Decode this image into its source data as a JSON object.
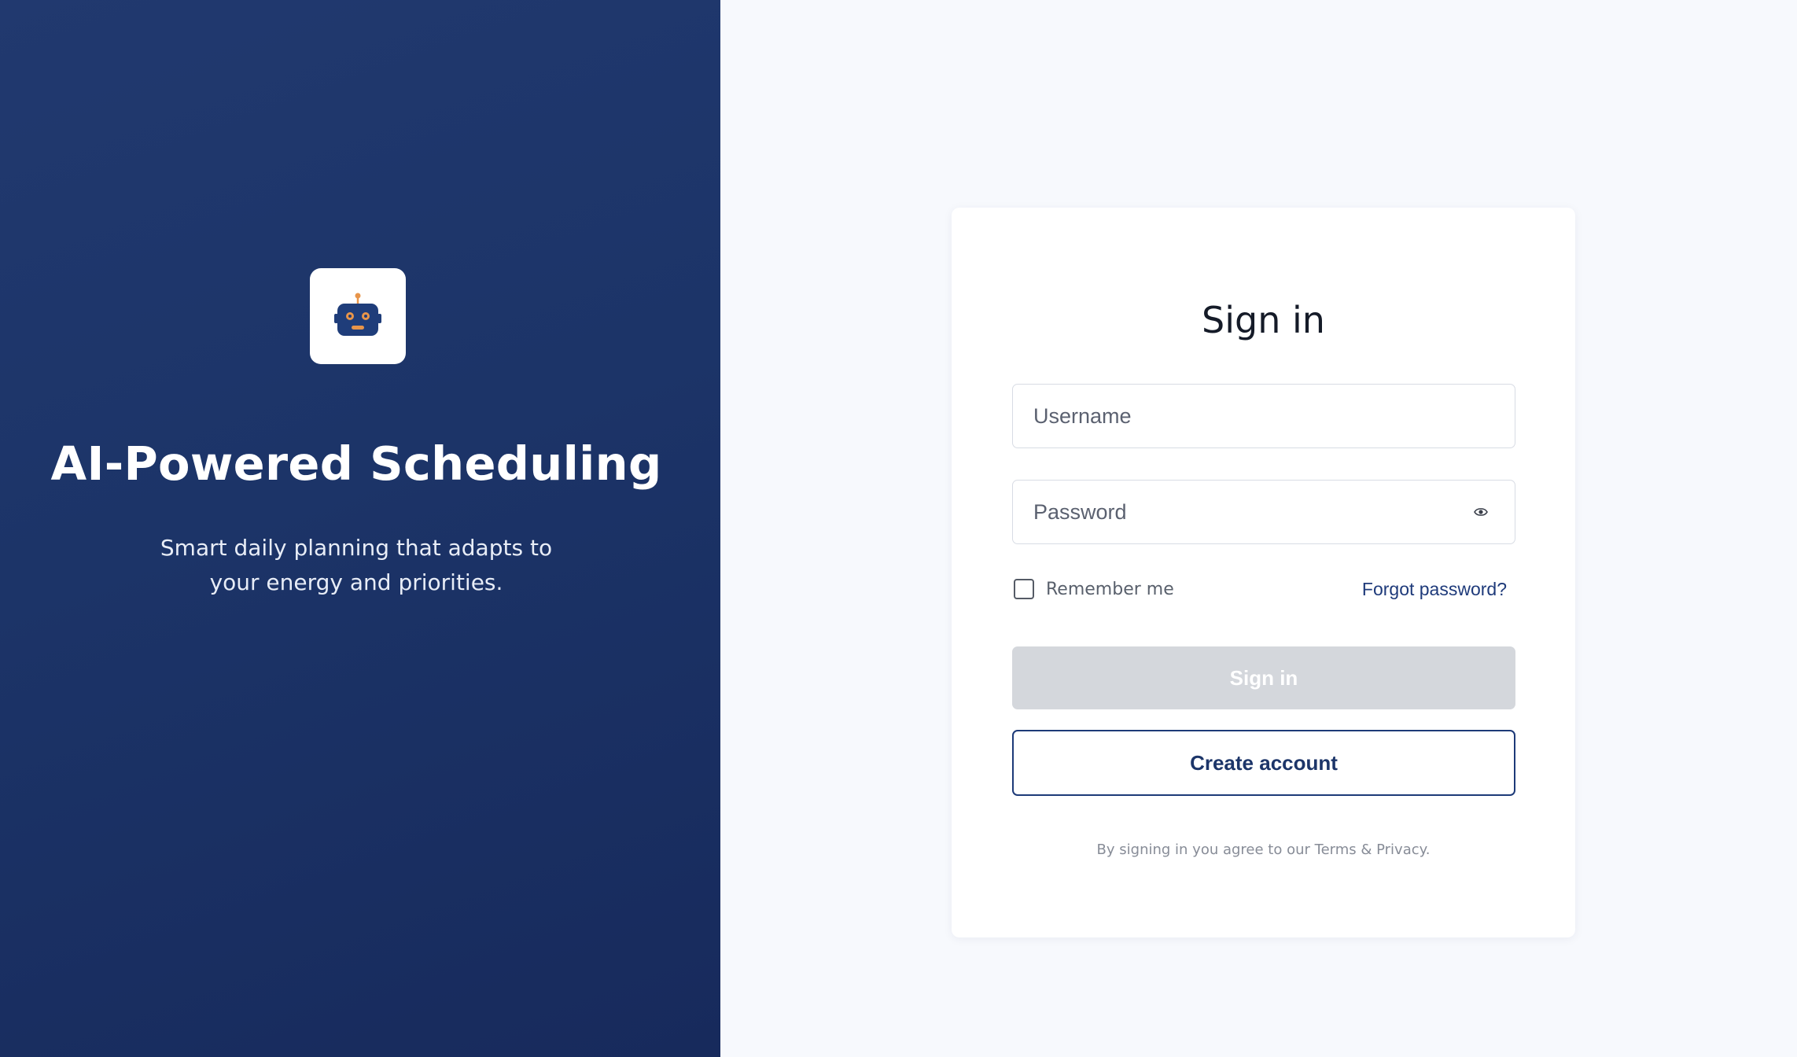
{
  "hero": {
    "logo_icon": "robot-icon",
    "title": "AI-Powered Scheduling",
    "subtitle_lines": [
      "Smart daily planning that adapts to",
      "your energy and priorities."
    ]
  },
  "login": {
    "title": "Sign in",
    "username_placeholder": "Username",
    "password_placeholder": "Password",
    "password_toggle_icon": "eye-icon",
    "remember_label": "Remember me",
    "remember_checked": false,
    "forgot_label": "Forgot password?",
    "signin_label": "Sign in",
    "signin_disabled": true,
    "create_label": "Create account",
    "legal_text": "By signing in you agree to our Terms & Privacy."
  },
  "colors": {
    "hero_bg": "#1c3468",
    "accent": "#1e3a7a",
    "robot_body": "#1f3d7a",
    "robot_detail": "#e8954a",
    "disabled_button": "#d4d7dc"
  }
}
